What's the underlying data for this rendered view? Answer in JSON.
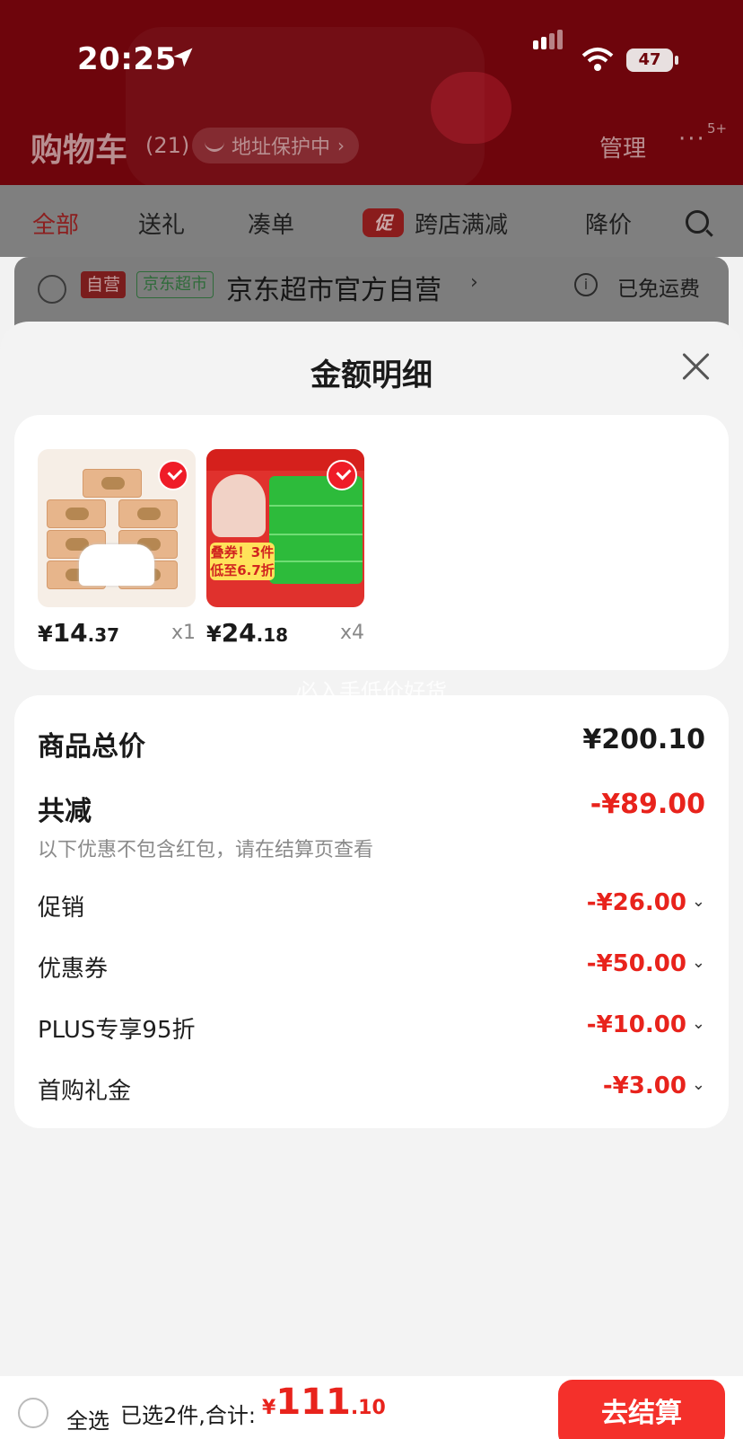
{
  "status_bar": {
    "time": "20:25",
    "battery": "47"
  },
  "header": {
    "title": "购物车",
    "count": "(21)",
    "address_protect": "地址保护中",
    "manage": "管理",
    "more": "···",
    "more_badge": "5+"
  },
  "tabs": {
    "all": "全部",
    "gift": "送礼",
    "bundle": "凑单",
    "promo_tag": "促",
    "cross_store": "跨店满减",
    "price_drop": "降价"
  },
  "store": {
    "tag_self": "自营",
    "tag_jd": "京东超市",
    "name": "京东超市官方自营",
    "shipping": "已免运费"
  },
  "sheet": {
    "title": "金额明细",
    "products": [
      {
        "price_symbol": "¥",
        "price_int": "14",
        "price_dec": ".37",
        "qty": "x1"
      },
      {
        "price_symbol": "¥",
        "price_int": "24",
        "price_dec": ".18",
        "qty": "x4",
        "img_promo": "叠券！3件 低至6.7折"
      }
    ],
    "watermark": "必入手低价好货",
    "details": {
      "total_label": "商品总价",
      "total_value": "¥200.10",
      "reduce_label": "共减",
      "reduce_value": "-¥89.00",
      "note": "以下优惠不包含红包，请在结算页查看",
      "items": [
        {
          "label": "促销",
          "value": "-¥26.00"
        },
        {
          "label": "优惠券",
          "value": "-¥50.00"
        },
        {
          "label": "PLUS专享95折",
          "value": "-¥10.00"
        },
        {
          "label": "首购礼金",
          "value": "-¥3.00"
        }
      ]
    }
  },
  "bottom_bar": {
    "select_all": "全选",
    "selected_summary": "已选2件,合计:",
    "total_symbol": "¥",
    "total_int": "111",
    "total_dec": ".10",
    "checkout": "去结算"
  },
  "colors": {
    "accent_red": "#e8231c",
    "checkout_red": "#f4302b",
    "header_dark_red": "#6e050c"
  }
}
